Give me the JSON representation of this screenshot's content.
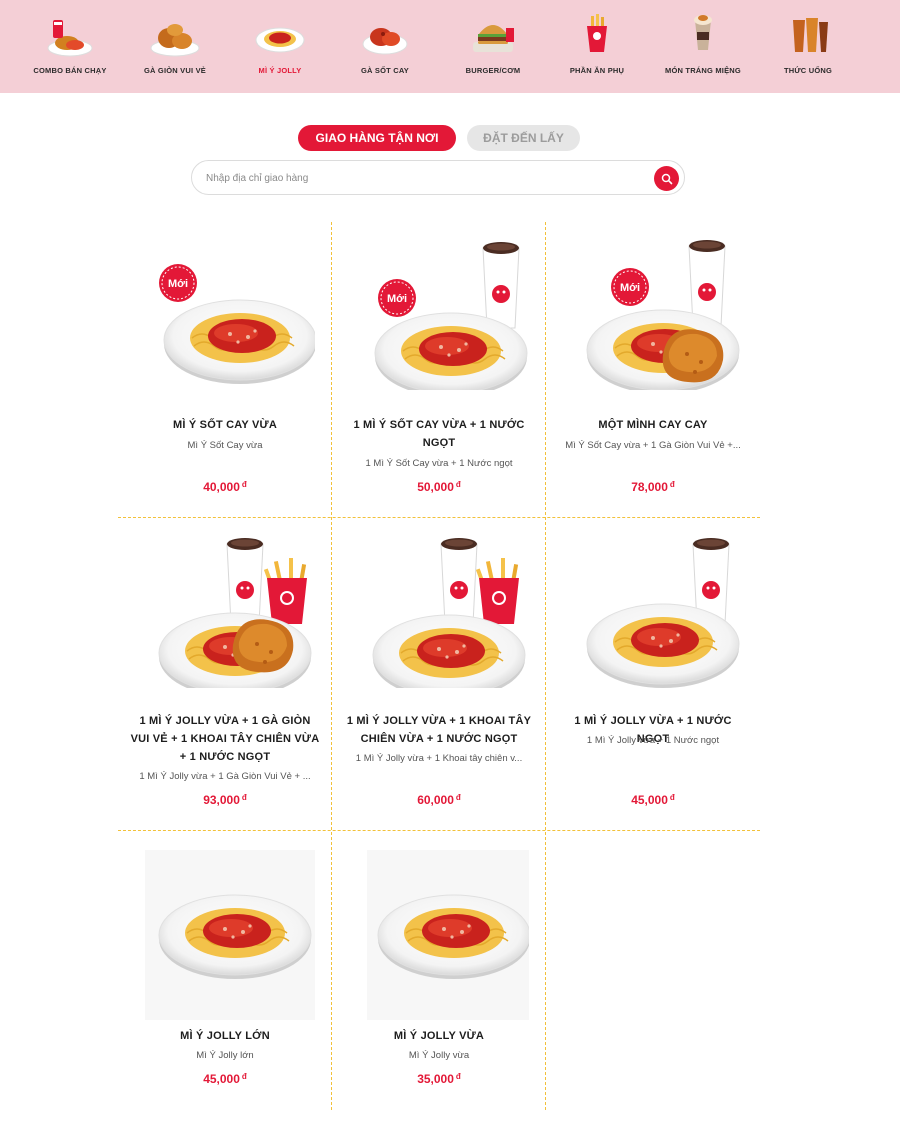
{
  "categories": [
    {
      "label": "COMBO BÁN CHẠY",
      "icon": "combo-meal-icon"
    },
    {
      "label": "GÀ GIÒN VUI VẺ",
      "icon": "fried-chicken-icon"
    },
    {
      "label": "MÌ Ý JOLLY",
      "icon": "spaghetti-icon",
      "active": true
    },
    {
      "label": "GÀ SỐT CAY",
      "icon": "spicy-chicken-icon"
    },
    {
      "label": "BURGER/CƠM",
      "icon": "burger-icon"
    },
    {
      "label": "PHẦN ĂN PHỤ",
      "icon": "fries-icon"
    },
    {
      "label": "MÓN TRÁNG MIỆNG",
      "icon": "dessert-icon"
    },
    {
      "label": "THỨC UỐNG",
      "icon": "drinks-icon"
    }
  ],
  "tabs": {
    "delivery": "GIAO HÀNG TẬN NƠI",
    "pickup": "ĐẶT ĐẾN LẤY"
  },
  "search": {
    "placeholder": "Nhập địa chỉ giao hàng",
    "value": ""
  },
  "badge": {
    "new": "Mới"
  },
  "currency": "đ",
  "products": [
    {
      "name": "MÌ Ý SỐT CAY VỪA",
      "desc": "Mì Ý Sốt Cay vừa",
      "price": "40,000"
    },
    {
      "name": "1 MÌ Ý SỐT CAY VỪA + 1 NƯỚC NGỌT",
      "desc": "1 Mì Ý Sốt Cay vừa + 1 Nước ngọt",
      "price": "50,000"
    },
    {
      "name": "MỘT MÌNH CAY CAY",
      "desc": "Mì Ý Sốt Cay vừa + 1 Gà Giòn Vui Vẻ +...",
      "price": "78,000"
    },
    {
      "name": "1 MÌ Ý JOLLY VỪA + 1 GÀ GIÒN VUI VẺ + 1 KHOAI TÂY CHIÊN VỪA + 1 NƯỚC NGỌT",
      "desc": "1 Mì Ý Jolly vừa + 1 Gà Giòn Vui Vẻ + ...",
      "price": "93,000"
    },
    {
      "name": "1 MÌ Ý JOLLY VỪA + 1 KHOAI TÂY CHIÊN VỪA + 1 NƯỚC NGỌT",
      "desc": "1 Mì Ý Jolly vừa + 1 Khoai tây chiên v...",
      "price": "60,000"
    },
    {
      "name": "1 MÌ Ý JOLLY VỪA + 1 NƯỚC NGỌT",
      "desc": "1 Mì Ý Jolly vừa + 1 Nước ngọt",
      "price": "45,000"
    },
    {
      "name": "MÌ Ý JOLLY LỚN",
      "desc": "Mì Ý Jolly lớn",
      "price": "45,000"
    },
    {
      "name": "MÌ Ý JOLLY VỪA",
      "desc": "Mì Ý Jolly vừa",
      "price": "35,000"
    }
  ],
  "colors": {
    "brand_red": "#e31837",
    "category_bg": "#f4cfd6",
    "divider": "#f2c13a"
  }
}
